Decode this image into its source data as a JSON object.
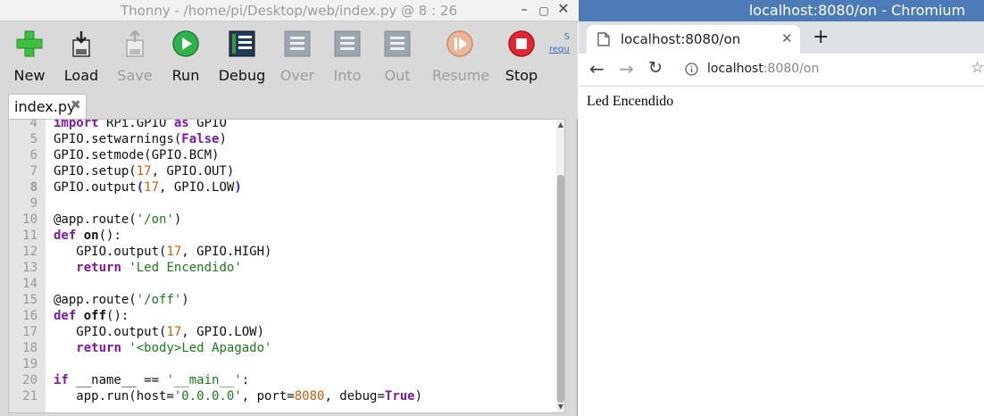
{
  "thonny": {
    "title": "Thonny  -  /home/pi/Desktop/web/index.py  @  8 : 26",
    "controls": {
      "minimize": "–",
      "maximize": "▢",
      "close": "✕"
    },
    "toolbar": {
      "new": "New",
      "load": "Load",
      "save": "Save",
      "run": "Run",
      "debug": "Debug",
      "over": "Over",
      "into": "Into",
      "out": "Out",
      "resume": "Resume",
      "stop": "Stop",
      "extra_line1": "S",
      "extra_line2": "requ"
    },
    "tab": {
      "label": "index.py",
      "close": "✖"
    },
    "code_lines": [
      {
        "n": "4",
        "html": "<span class='kw'>import</span> RPi.GPIO <span class='kw'>as</span> GPIO"
      },
      {
        "n": "5",
        "html": "GPIO.setwarnings(<span class='kw'>False</span>)"
      },
      {
        "n": "6",
        "html": "GPIO.setmode(GPIO.BCM)"
      },
      {
        "n": "7",
        "html": "GPIO.setup(<span class='num'>17</span>, GPIO.OUT)"
      },
      {
        "n": "8",
        "html": "GPIO.output<span class='kw2'>(</span><span class='num'>17</span>, GPIO.LOW<span class='kw2'>)</span>"
      },
      {
        "n": "9",
        "html": ""
      },
      {
        "n": "10",
        "html": "@app.route(<span class='str'>'/on'</span>)"
      },
      {
        "n": "11",
        "html": "<span class='kw'>def</span> <span class='bold'>on</span>():"
      },
      {
        "n": "12",
        "html": "   GPIO.output(<span class='num'>17</span>, GPIO.HIGH)"
      },
      {
        "n": "13",
        "html": "   <span class='kw'>return</span> <span class='str'>'Led Encendido'</span>"
      },
      {
        "n": "14",
        "html": ""
      },
      {
        "n": "15",
        "html": "@app.route(<span class='str'>'/off'</span>)"
      },
      {
        "n": "16",
        "html": "<span class='kw'>def</span> <span class='bold'>off</span>():"
      },
      {
        "n": "17",
        "html": "   GPIO.output(<span class='num'>17</span>, GPIO.LOW)"
      },
      {
        "n": "18",
        "html": "   <span class='kw'>return</span> <span class='str'>'&lt;body&gt;Led Apagado'</span>"
      },
      {
        "n": "19",
        "html": ""
      },
      {
        "n": "20",
        "html": "<span class='kw'>if</span> __name__ == <span class='str'>'__main__'</span>:"
      },
      {
        "n": "21",
        "html": "   app.run(host=<span class='str'>'0.0.0.0'</span>, port=<span class='num'>8080</span>, debug=<span class='kw'>True</span>)"
      }
    ],
    "current_line": "8"
  },
  "chromium": {
    "title": "localhost:8080/on - Chromium",
    "tab_title": "localhost:8080/on",
    "tab_close": "✕",
    "new_tab": "+",
    "back": "←",
    "forward": "→",
    "reload": "↻",
    "url_host": "localhost",
    "url_path": ":8080/on",
    "star": "☆",
    "page_text": "Led Encendido"
  },
  "colors": {
    "chromium_titlebar": "#4d7bb7",
    "thonny_bg": "#d9d9d9",
    "keyword": "#7d1a9e",
    "string": "#1e7a1e",
    "number": "#c65f12"
  }
}
